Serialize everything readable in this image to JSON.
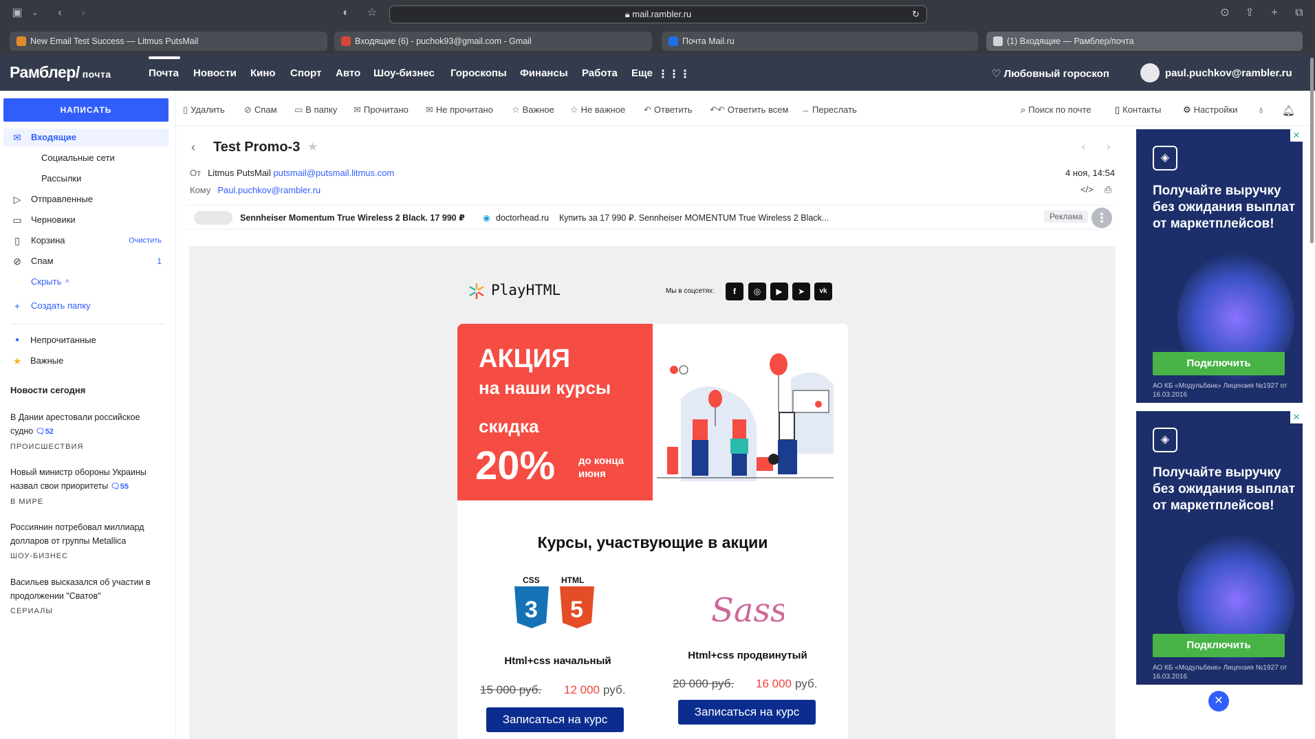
{
  "browser": {
    "url": "mail.rambler.ru",
    "tabs": [
      {
        "title": "New Email Test Success — Litmus PutsMail"
      },
      {
        "title": "Входящие (6) - puchok93@gmail.com - Gmail"
      },
      {
        "title": "Почта Mail.ru"
      },
      {
        "title": "(1) Входящие — Рамблер/почта"
      }
    ]
  },
  "header": {
    "logo": "Рамблер/",
    "logo_suffix": "почта",
    "nav": [
      "Почта",
      "Новости",
      "Кино",
      "Спорт",
      "Авто",
      "Шоу-бизнес",
      "Гороскопы",
      "Финансы",
      "Работа",
      "Еще"
    ],
    "horoscope": "Любовный гороскоп",
    "user": "paul.puchkov@rambler.ru"
  },
  "sidebar": {
    "compose": "НАПИСАТЬ",
    "folders": [
      {
        "label": "Входящие",
        "icon": "mail-icon"
      },
      {
        "label": "Социальные сети"
      },
      {
        "label": "Рассылки"
      },
      {
        "label": "Отправленные",
        "icon": "send-icon"
      },
      {
        "label": "Черновики",
        "icon": "draft-icon"
      },
      {
        "label": "Корзина",
        "icon": "trash-icon",
        "action": "Очистить"
      },
      {
        "label": "Спам",
        "icon": "spam-icon",
        "count": "1"
      },
      {
        "label": "Скрыть"
      },
      {
        "label": "Создать папку",
        "icon": "plus-icon"
      },
      {
        "label": "Непрочитанные"
      },
      {
        "label": "Важные"
      }
    ],
    "news_title": "Новости сегодня",
    "news": [
      {
        "text": "В Дании арестовали российское судно",
        "count": "52",
        "category": "ПРОИСШЕСТВИЯ"
      },
      {
        "text": "Новый министр обороны Украины назвал свои приоритеты",
        "count": "55",
        "category": "В МИРЕ"
      },
      {
        "text": "Россиянин потребовал миллиард долларов от группы Metallica",
        "count": "",
        "category": "ШОУ-БИЗНЕС"
      },
      {
        "text": "Васильев высказался об участии в продолжении \"Сватов\"",
        "count": "",
        "category": "СЕРИАЛЫ"
      }
    ]
  },
  "toolbar": {
    "items": [
      "Удалить",
      "Спам",
      "В папку",
      "Прочитано",
      "Не прочитано",
      "Важное",
      "Не важное",
      "Ответить",
      "Ответить всем",
      "Переслать"
    ],
    "right": [
      "Поиск по почте",
      "Контакты",
      "Настройки"
    ]
  },
  "message": {
    "subject": "Test Promo-3",
    "from_label": "От",
    "from_name": "Litmus PutsMail",
    "from_email": "putsmail@putsmail.litmus.com",
    "to_label": "Кому",
    "to": "Paul.puchkov@rambler.ru",
    "date": "4 ноя, 14:54"
  },
  "adbar": {
    "title": "Sennheiser Momentum True Wireless 2 Black. 17 990 ₽",
    "domain": "doctorhead.ru",
    "text": "Купить за 17 990 ₽. Sennheiser MOMENTUM True Wireless 2 Black...",
    "badge": "Реклама"
  },
  "email": {
    "brand": "PlayHTML",
    "social_text": "Мы в соцсетях:",
    "promo": {
      "line1": "АКЦИЯ",
      "line2": "на наши курсы",
      "line3": "скидка",
      "percent": "20%",
      "until": "до конца июня"
    },
    "courses_title": "Курсы, участвующие в акции",
    "courses": [
      {
        "name": "Html+css начальный",
        "old_price": "15 000 руб.",
        "new_price": "12 000",
        "currency": "руб.",
        "button": "Записаться на курс"
      },
      {
        "name": "Html+css продвинутый",
        "old_price": "20 000 руб.",
        "new_price": "16 000",
        "currency": "руб.",
        "button": "Записаться на курс"
      }
    ],
    "logo_labels": {
      "css": "CSS",
      "html": "HTML",
      "sass": "Sass"
    }
  },
  "ads": [
    {
      "headline": "Получайте выручку без ожидания выплат от маркетплейсов!",
      "button": "Подключить",
      "legal": "АО КБ «Модульбанк» Лицензия №1927 от 16.03.2016"
    },
    {
      "headline": "Получайте выручку без ожидания выплат от маркетплейсов!",
      "button": "Подключить",
      "legal": "АО КБ «Модульбанк» Лицензия №1927 от 16.03.2016"
    }
  ],
  "colors": {
    "accent": "#315efb",
    "promo": "#f54c44",
    "button": "#0b2d8f",
    "header": "#343b4c"
  }
}
